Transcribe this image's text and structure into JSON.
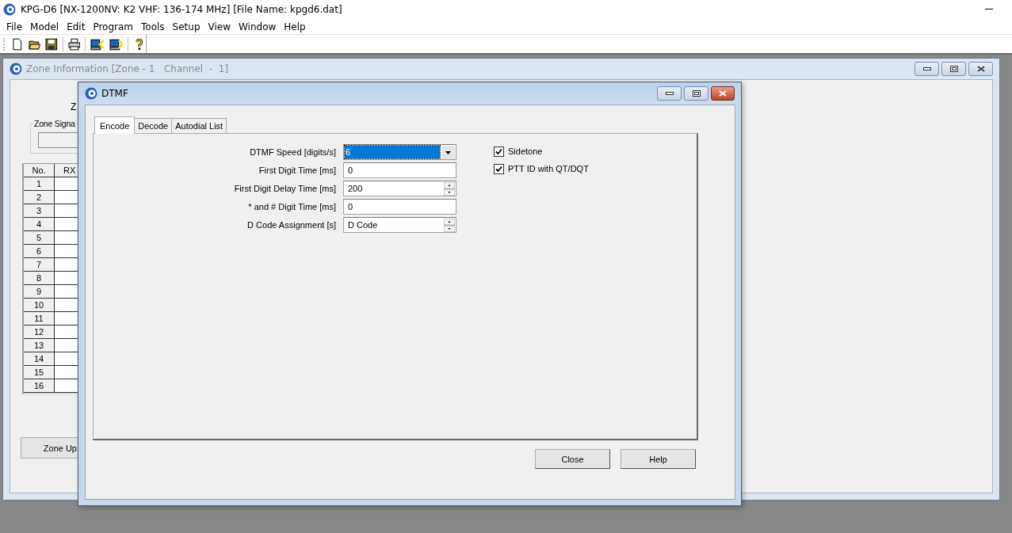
{
  "app_window": {
    "title": "KPG-D6 [NX-1200NV: K2 VHF: 136-174 MHz] [File Name: kpgd6.dat]"
  },
  "menu": [
    "File",
    "Model",
    "Edit",
    "Program",
    "Tools",
    "Setup",
    "View",
    "Window",
    "Help"
  ],
  "toolbar": [
    {
      "kind": "new"
    },
    {
      "kind": "open"
    },
    {
      "kind": "save"
    },
    {
      "kind": "separator"
    },
    {
      "kind": "print"
    },
    {
      "kind": "separator"
    },
    {
      "kind": "read"
    },
    {
      "kind": "write"
    },
    {
      "kind": "separator"
    },
    {
      "kind": "help"
    }
  ],
  "zone_window": {
    "title": "Zone Information [Zone - 1   Channel  -  1]",
    "active": false,
    "label": "Z",
    "group_title": "Zone Signa",
    "table": {
      "columns": [
        "No.",
        "RX"
      ],
      "rows": [
        "1",
        "2",
        "3",
        "4",
        "5",
        "6",
        "7",
        "8",
        "9",
        "10",
        "11",
        "12",
        "13",
        "14",
        "15",
        "16"
      ]
    },
    "button": "Zone Up"
  },
  "dtmf_window": {
    "title": "DTMF",
    "active": true,
    "tabs": [
      {
        "label": "Encode",
        "selected": true
      },
      {
        "label": "Decode",
        "selected": false
      },
      {
        "label": "Autodial List",
        "selected": false
      }
    ],
    "fields": [
      {
        "label": "DTMF Speed [digits/s]",
        "kind": "dropdown",
        "value": "6",
        "highlighted": true
      },
      {
        "label": "First Digit Time [ms]",
        "kind": "text",
        "value": "0",
        "highlighted": false
      },
      {
        "label": "First Digit Delay Time [ms]",
        "kind": "spin",
        "value": "200",
        "highlighted": false
      },
      {
        "label": "* and # Digit Time [ms]",
        "kind": "text",
        "value": "0",
        "highlighted": false
      },
      {
        "label": "D Code Assignment [s]",
        "kind": "spin",
        "value": "D Code",
        "highlighted": false
      }
    ],
    "checkboxes": [
      {
        "label": "Sidetone",
        "checked": true
      },
      {
        "label": "PTT ID with QT/DQT",
        "checked": true
      }
    ],
    "buttons": [
      "Close",
      "Help"
    ]
  }
}
